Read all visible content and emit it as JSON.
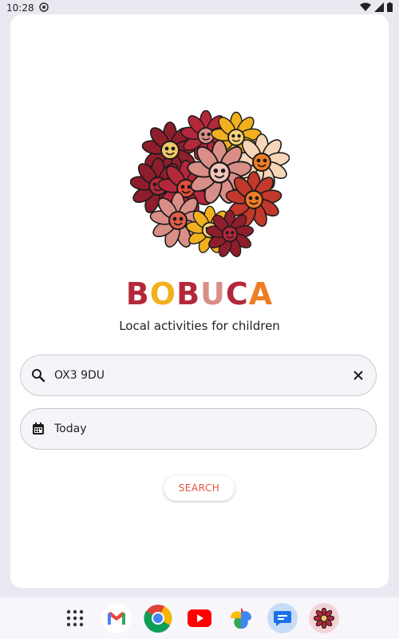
{
  "status_bar": {
    "time": "10:28",
    "icons": [
      "notification-icon",
      "wifi-icon",
      "signal-icon",
      "battery-icon"
    ]
  },
  "brand": {
    "letters": [
      {
        "char": "B",
        "color": "#b3283a"
      },
      {
        "char": "O",
        "color": "#f2b01e"
      },
      {
        "char": "B",
        "color": "#b3283a"
      },
      {
        "char": "U",
        "color": "#d98f87"
      },
      {
        "char": "C",
        "color": "#b3283a"
      },
      {
        "char": "A",
        "color": "#ee7d25"
      }
    ],
    "tagline": "Local activities for children"
  },
  "search": {
    "location_value": "OX3 9DU",
    "date_value": "Today",
    "button_label": "SEARCH"
  },
  "dock": {
    "apps": [
      "app-drawer-icon",
      "gmail-icon",
      "chrome-icon",
      "youtube-icon",
      "photos-icon",
      "messages-icon",
      "bobuca-app-icon"
    ]
  },
  "colors": {
    "accent": "#e2523b",
    "background": "#e9e9f1"
  }
}
